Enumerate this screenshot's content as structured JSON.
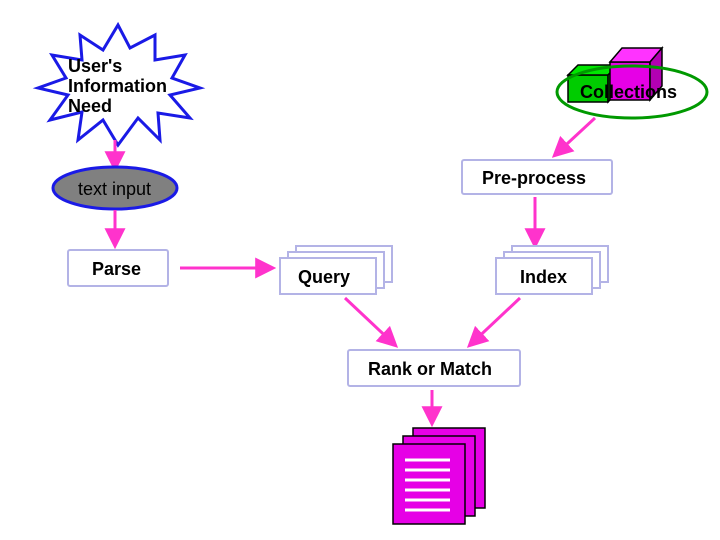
{
  "nodes": {
    "userNeed": {
      "line1": "User's",
      "line2": "Information",
      "line3": "Need"
    },
    "collections": "Collections",
    "preprocess": "Pre-process",
    "textInput": "text input",
    "parse": "Parse",
    "query": "Query",
    "index": "Index",
    "rankMatch": "Rank or Match"
  },
  "colors": {
    "blueStroke": "#1a1ae6",
    "lavenderStroke": "#b3b3e6",
    "greenStroke": "#009900",
    "pinkArrow": "#ff33cc",
    "magenta": "#e600e6",
    "green": "#00cc00",
    "gray": "#808080"
  }
}
